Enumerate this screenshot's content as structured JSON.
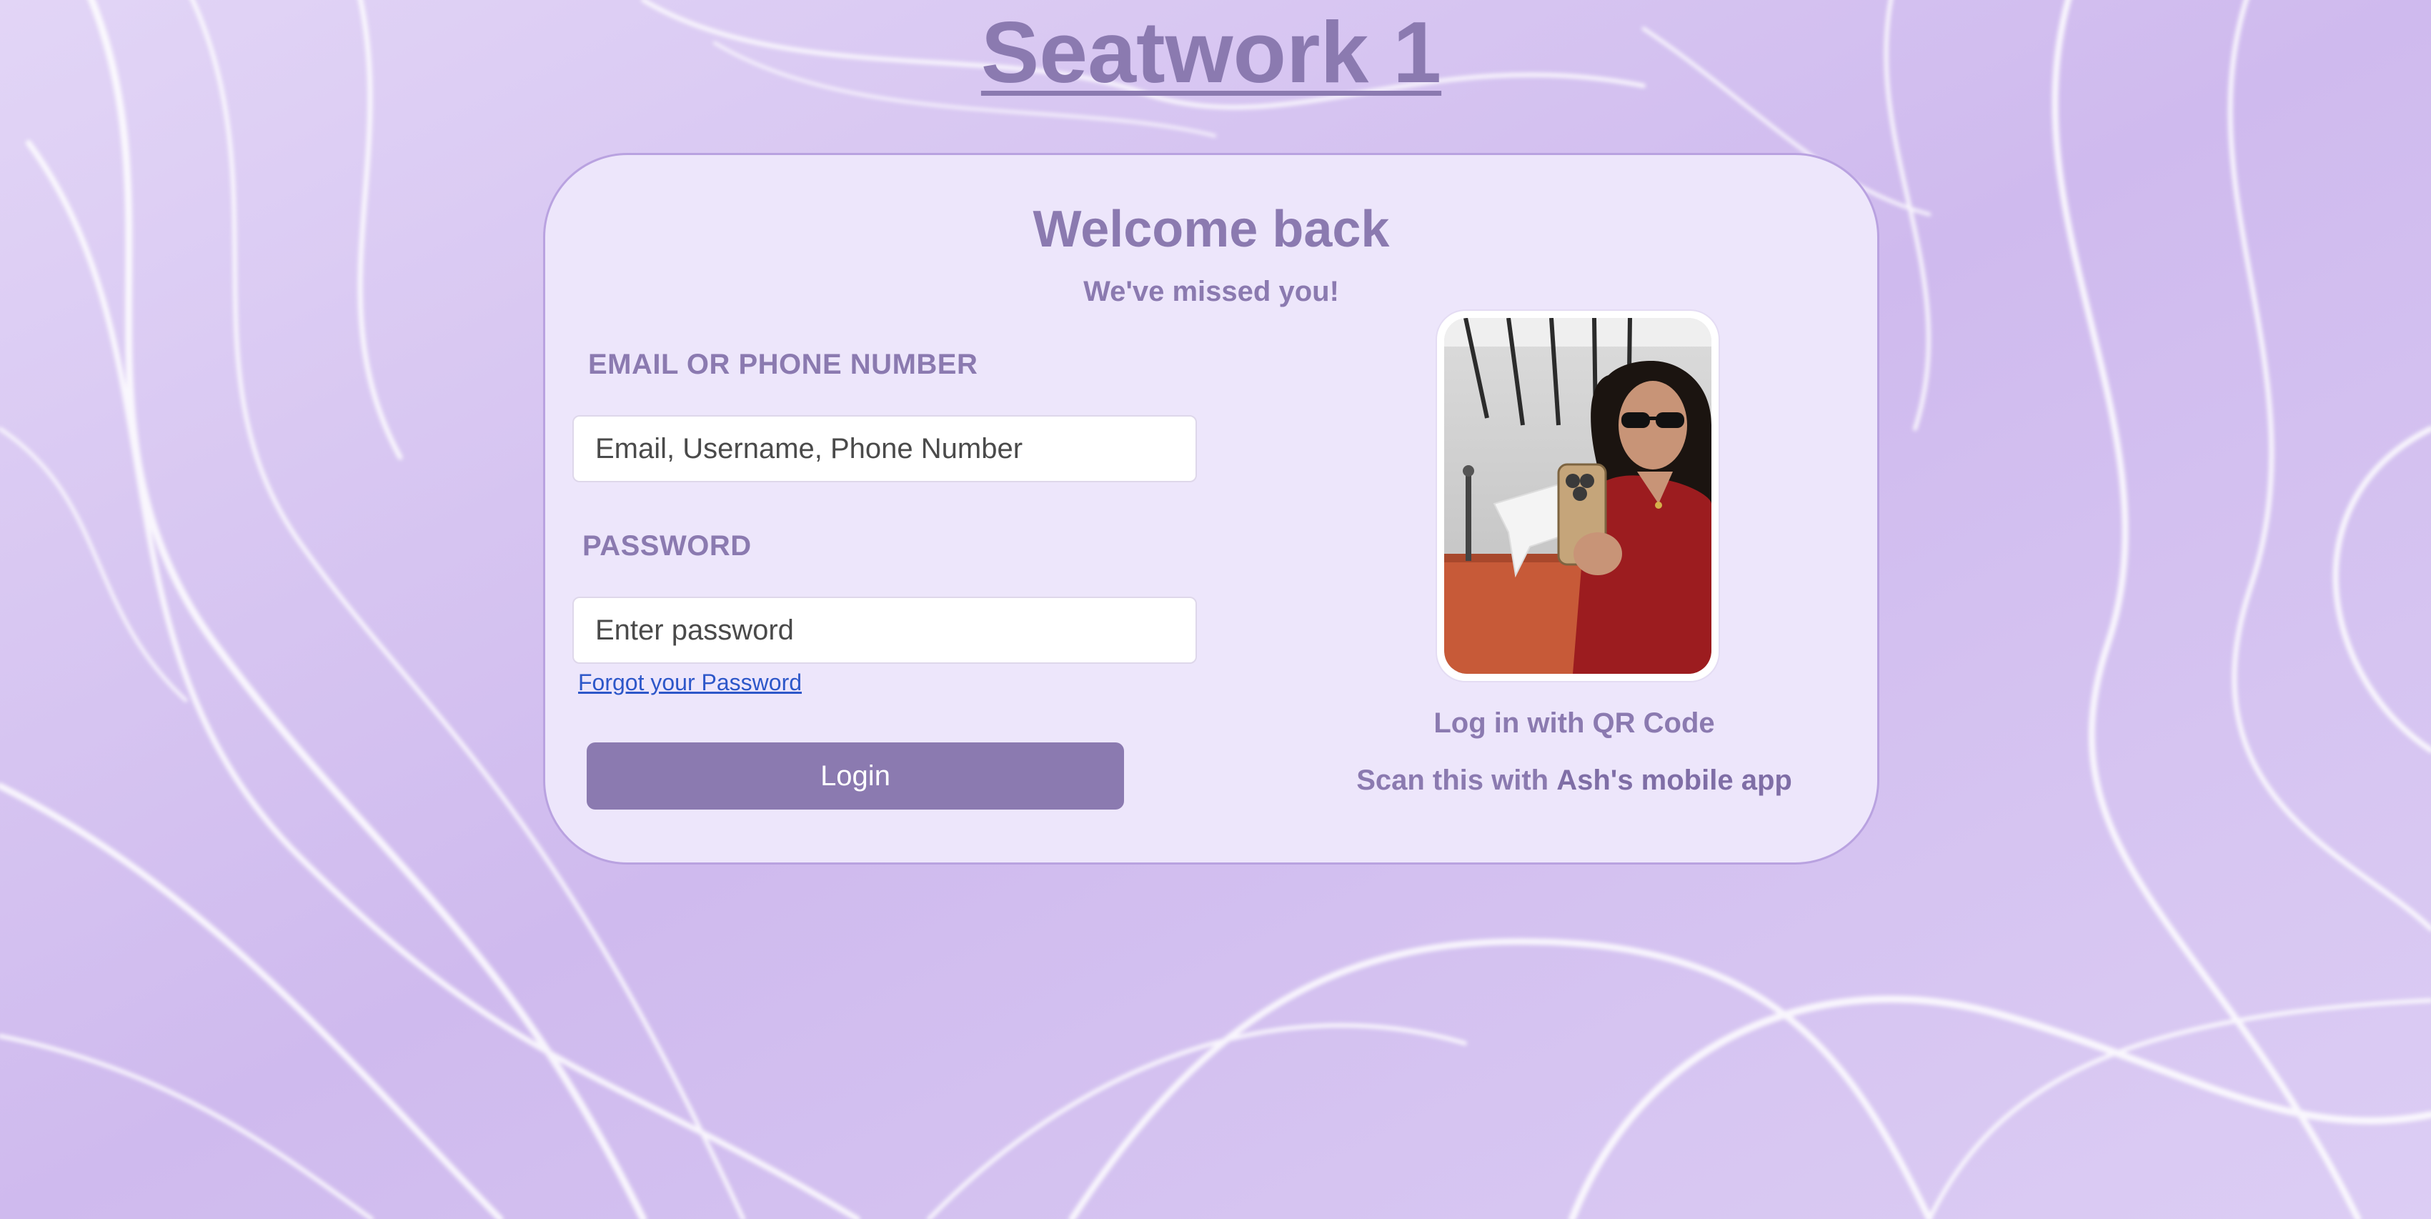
{
  "page": {
    "title": "Seatwork 1"
  },
  "login_card": {
    "heading": "Welcome back",
    "subheading": "We've missed you!",
    "email_label": "EMAIL OR PHONE NUMBER",
    "email_placeholder": "Email, Username, Phone Number",
    "email_value": "",
    "password_label": "PASSWORD",
    "password_placeholder": "Enter password",
    "password_value": "",
    "forgot_password_link": "Forgot your Password",
    "login_button": "Login"
  },
  "qr_section": {
    "label": "Log in with QR Code",
    "scan_prefix": "Scan this with ",
    "scan_app_name": "Ash's mobile app"
  },
  "colors": {
    "accent": "#8b7ab0",
    "card_background": "#ede6fb",
    "card_border": "#b9a2e0",
    "link": "#2d57c9",
    "background": "#d9c9f2"
  }
}
